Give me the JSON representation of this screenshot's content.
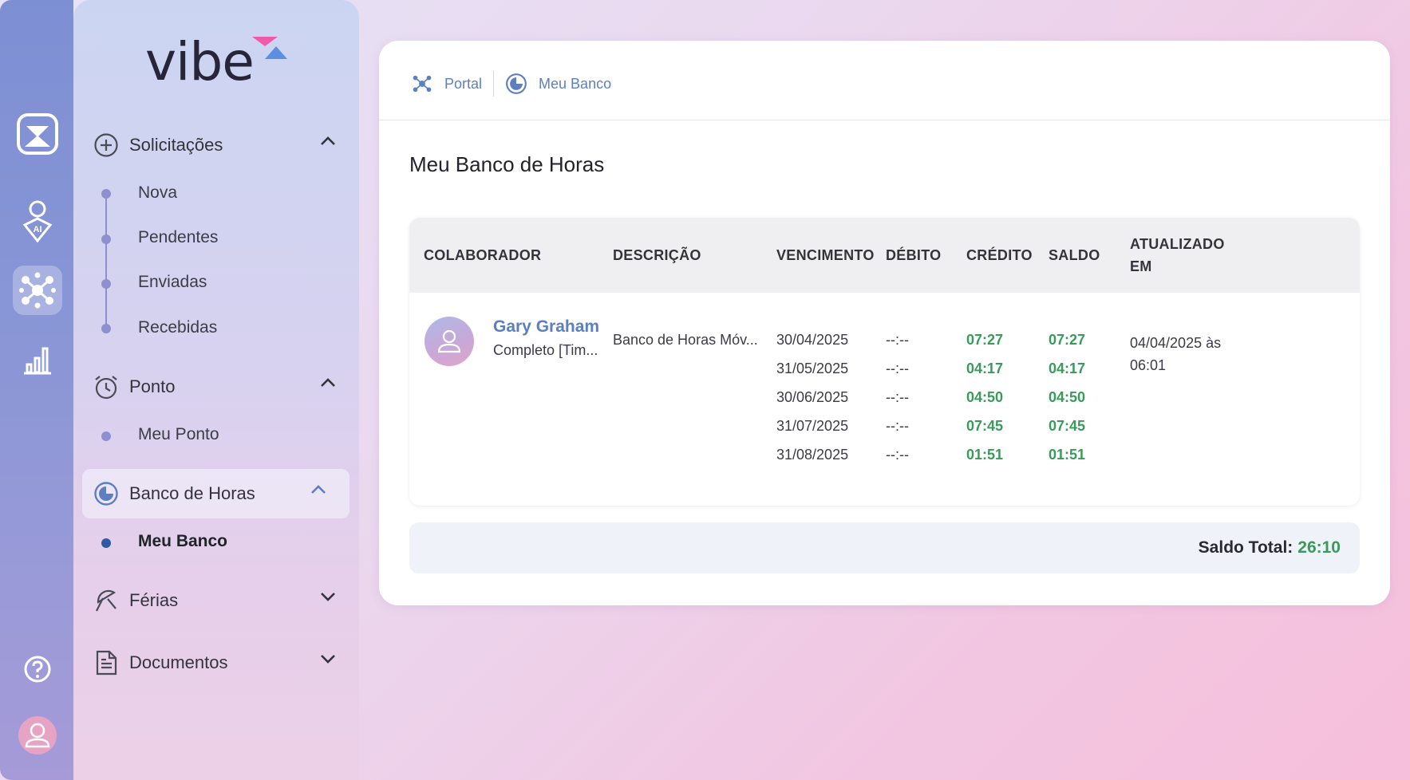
{
  "app": {
    "logo_text": "vibe"
  },
  "rail": {
    "icons": [
      "inbox-icon",
      "ai-user-icon",
      "network-icon",
      "chart-icon",
      "help-icon",
      "user-avatar-icon"
    ],
    "active": "network-icon"
  },
  "sidebar": {
    "sections": [
      {
        "label": "Solicitações",
        "icon": "plus-circle-icon",
        "expanded": true,
        "items": [
          "Nova",
          "Pendentes",
          "Enviadas",
          "Recebidas"
        ]
      },
      {
        "label": "Ponto",
        "icon": "alarm-clock-icon",
        "expanded": true,
        "items": [
          "Meu Ponto"
        ]
      },
      {
        "label": "Banco de Horas",
        "icon": "clock-bank-icon",
        "expanded": true,
        "active": true,
        "items": [
          "Meu Banco"
        ]
      },
      {
        "label": "Férias",
        "icon": "umbrella-icon",
        "expanded": false,
        "items": []
      },
      {
        "label": "Documentos",
        "icon": "document-icon",
        "expanded": false,
        "items": []
      }
    ]
  },
  "breadcrumb": {
    "portal": "Portal",
    "current": "Meu Banco"
  },
  "page_title": "Meu Banco de Horas",
  "table": {
    "headers": {
      "colaborador": "COLABORADOR",
      "descricao": "DESCRIÇÃO",
      "vencimento": "VENCIMENTO",
      "debito": "DÉBITO",
      "credito": "CRÉDITO",
      "saldo": "SALDO",
      "atualizado_1": "ATUALIZADO",
      "atualizado_2": "EM"
    },
    "row": {
      "name": "Gary Graham",
      "role": "Completo [Tim...",
      "description": "Banco de Horas Móv...",
      "updated_1": "04/04/2025 às",
      "updated_2": "06:01",
      "entries": [
        {
          "vencimento": "30/04/2025",
          "debito": "--:--",
          "credito": "07:27",
          "saldo": "07:27"
        },
        {
          "vencimento": "31/05/2025",
          "debito": "--:--",
          "credito": "04:17",
          "saldo": "04:17"
        },
        {
          "vencimento": "30/06/2025",
          "debito": "--:--",
          "credito": "04:50",
          "saldo": "04:50"
        },
        {
          "vencimento": "31/07/2025",
          "debito": "--:--",
          "credito": "07:45",
          "saldo": "07:45"
        },
        {
          "vencimento": "31/08/2025",
          "debito": "--:--",
          "credito": "01:51",
          "saldo": "01:51"
        }
      ]
    }
  },
  "total": {
    "label": "Saldo Total:",
    "value": "26:10"
  },
  "colors": {
    "accent": "#5b7fc1",
    "positive": "#3a9a5c",
    "active_dot": "#2d5aa3"
  }
}
